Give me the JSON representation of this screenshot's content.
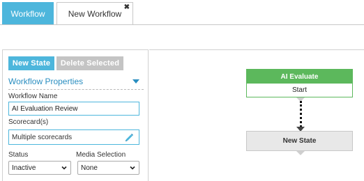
{
  "tabs": [
    {
      "label": "Workflow",
      "active": true
    },
    {
      "label": "New Workflow",
      "active": false,
      "close_glyph": "✖"
    }
  ],
  "toolbar": {
    "new_state_label": "New State",
    "delete_selected_label": "Delete Selected"
  },
  "properties": {
    "section_title": "Workflow Properties",
    "workflow_name_label": "Workflow Name",
    "workflow_name_value": "AI Evaluation Review",
    "scorecards_label": "Scorecard(s)",
    "scorecards_value": "Multiple scorecards",
    "status_label": "Status",
    "status_value": "Inactive",
    "media_label": "Media Selection",
    "media_value": "None"
  },
  "canvas": {
    "nodes": [
      {
        "title": "AI Evaluate",
        "subtitle": "Start"
      },
      {
        "title": "New State"
      }
    ]
  },
  "colors": {
    "accent": "#4db6dc",
    "link_blue": "#2a8ec0",
    "node_green": "#5cb85c",
    "disabled_gray": "#c4c4c4",
    "node_gray": "#e8e8e8"
  },
  "icons": [
    "close-icon",
    "chevron-down-icon",
    "pencil-icon"
  ]
}
